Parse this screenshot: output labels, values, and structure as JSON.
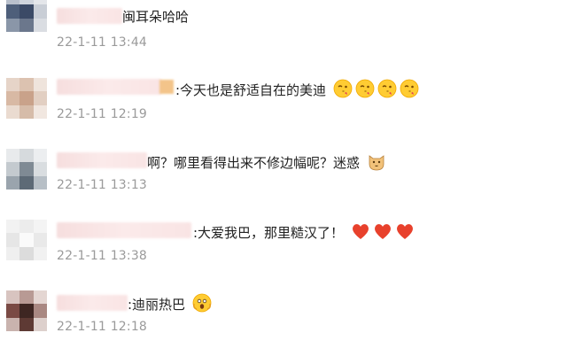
{
  "comments": [
    {
      "text": "闽耳朵哈哈",
      "time": "22-1-11 13:44"
    },
    {
      "text": ":今天也是舒适自在的美迪",
      "time": "22-1-11 12:19",
      "emoji": "blowing-kiss-emoji x4"
    },
    {
      "text": "啊？哪里看得出来不修边幅呢？迷惑",
      "time": "22-1-11 13:13",
      "emoji": "cat-emoji"
    },
    {
      "text": ":大爱我巴，那里糙汉了！",
      "time": "22-1-11 13:38",
      "emoji": "red-heart-emoji x3"
    },
    {
      "text": ":迪丽热巴",
      "time": "22-1-11 12:18",
      "emoji": "shocked-emoji"
    }
  ]
}
